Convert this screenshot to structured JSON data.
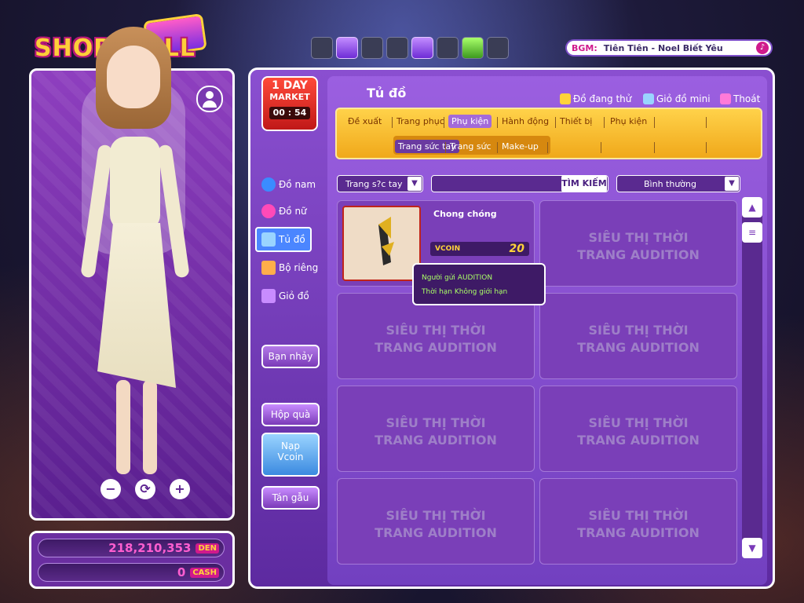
{
  "logo": {
    "text": "SHOP MALL"
  },
  "bgm": {
    "label": "BGM:",
    "song": "Tiên Tiên - Noel Biết Yêu"
  },
  "top_icons": [
    "channel-icon",
    "monster-icon",
    "smile-icon",
    "plant-icon",
    "tv-icon",
    "photo-icon",
    "khu-vuon-icon",
    "gift-icon"
  ],
  "day_market": {
    "line1": "1 DAY",
    "line2": "MARKET",
    "timer": "00 : 54"
  },
  "sidebar": {
    "items": [
      {
        "label": "Đồ nam",
        "icon": "male-icon"
      },
      {
        "label": "Đồ nữ",
        "icon": "female-icon"
      },
      {
        "label": "Tủ đồ",
        "icon": "wardrobe-icon",
        "active": true
      },
      {
        "label": "Bộ riêng",
        "icon": "bundle-icon"
      },
      {
        "label": "Giỏ đồ",
        "icon": "basket-icon"
      }
    ],
    "ban_nhay": "Bạn nhảy",
    "hop_qua": "Hộp quà",
    "nap_vcoin_1": "Nạp",
    "nap_vcoin_2": "Vcoin",
    "tan_gau": "Tán gẫu"
  },
  "shop": {
    "title": "Tủ đồ",
    "links": [
      "Đồ đang thử",
      "Giỏ đồ mini",
      "Thoát"
    ],
    "tabs": [
      "Đề xuất",
      "Trang phục",
      "Phụ kiện",
      "Hành động",
      "Thiết bị",
      "Phụ kiện"
    ],
    "active_tab": 2,
    "subtabs": [
      "Trang sức tay",
      "Trang sức",
      "Make-up"
    ],
    "active_subtab": 0,
    "filter_category": "Trang s?c tay",
    "search_label": "TÌM KIẾM",
    "filter_sort": "Bình thường",
    "placeholder_line1": "SIÊU THỊ THỜI",
    "placeholder_line2": "TRANG AUDITION"
  },
  "item": {
    "name": "Chong chóng",
    "currency": "VCOIN",
    "price": "20",
    "tooltip_sender": "Người gửi AUDITION",
    "tooltip_duration": "Thời hạn Không giới hạn"
  },
  "currency": {
    "den_amount": "218,210,353",
    "den_unit": "DEN",
    "cash_amount": "0",
    "cash_unit": "CASH"
  },
  "colors": {
    "accent": "#8a4fd0",
    "tab_bar": "#ffd24a",
    "price": "#ffd23a",
    "currency_text": "#ff5ed0"
  }
}
